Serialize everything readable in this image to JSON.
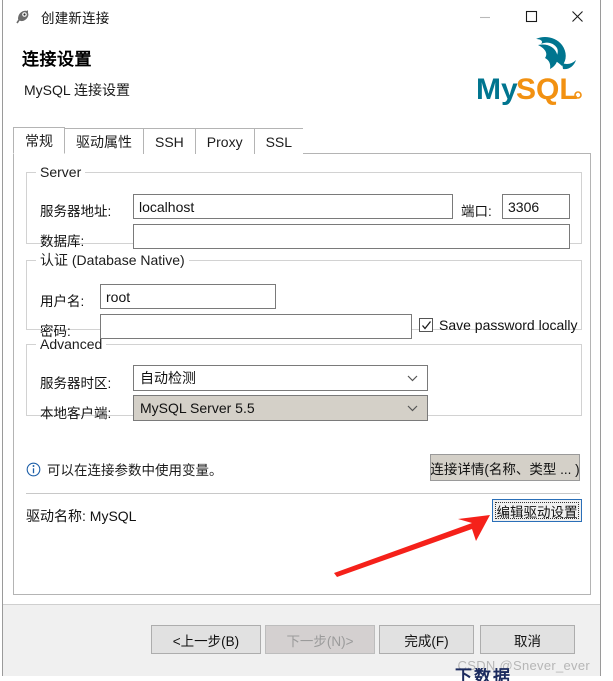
{
  "window": {
    "icon": "app-dbeaver-icon",
    "title": "创建新连接",
    "controls": {
      "minimize": "minimize-icon",
      "maximize": "maximize-icon",
      "close": "close-icon"
    }
  },
  "header": {
    "title": "连接设置",
    "subtitle": "MySQL 连接设置",
    "logo_text": "MySQL",
    "logo_colors": {
      "my": "#00758f",
      "sql": "#f29111"
    }
  },
  "tabs": [
    {
      "label": "常规",
      "active": true
    },
    {
      "label": "驱动属性",
      "active": false
    },
    {
      "label": "SSH",
      "active": false
    },
    {
      "label": "Proxy",
      "active": false
    },
    {
      "label": "SSL",
      "active": false
    }
  ],
  "groups": {
    "server": {
      "legend": "Server",
      "host_label": "服务器地址:",
      "host_value": "localhost",
      "port_label": "端口:",
      "port_value": "3306",
      "database_label": "数据库:",
      "database_value": ""
    },
    "auth": {
      "legend": "认证 (Database Native)",
      "username_label": "用户名:",
      "username_value": "root",
      "password_label": "密码:",
      "password_value": "",
      "save_password_label": "Save password locally",
      "save_password_checked": true
    },
    "advanced": {
      "legend": "Advanced",
      "timezone_label": "服务器时区:",
      "timezone_value": "自动检测",
      "client_label": "本地客户端:",
      "client_value": "MySQL Server 5.5"
    }
  },
  "info": {
    "icon": "info-circle-icon",
    "text": "可以在连接参数中使用变量。",
    "details_button": "连接详情(名称、类型 ... )"
  },
  "driver": {
    "label": "驱动名称: MySQL",
    "edit_button": "编辑驱动设置"
  },
  "footer": {
    "buttons": [
      {
        "label": "<上一步(B)",
        "disabled": false
      },
      {
        "label": "下一步(N)>",
        "disabled": true
      },
      {
        "label": "完成(F)",
        "disabled": false
      },
      {
        "label": "取消",
        "disabled": false
      }
    ],
    "watermark": "CSDN @Snever_ever",
    "bleed_text": "下数据"
  },
  "annotation": {
    "arrow": "red-arrow-annotation",
    "color": "#f5211a"
  }
}
